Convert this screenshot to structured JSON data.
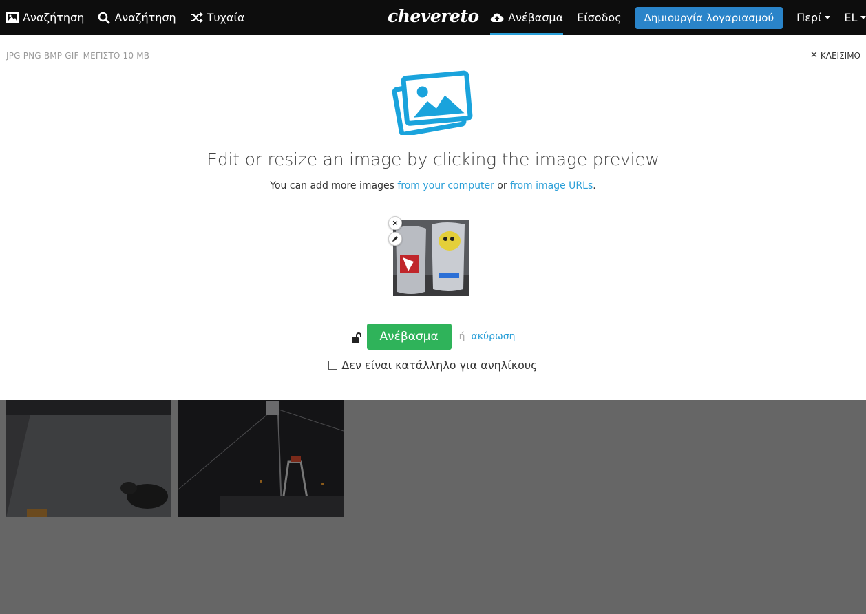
{
  "nav": {
    "images_label": "Αναζήτηση",
    "search_label": "Αναζήτηση",
    "random_label": "Τυχαία",
    "logo_text": "chevereto",
    "upload_label": "Ανέβασμα",
    "login_label": "Είσοδος",
    "signup_label": "Δημιουργία λογαριασμού",
    "about_label": "Περί",
    "language_label": "EL"
  },
  "panel": {
    "formats": "JPG PNG BMP GIF",
    "max_size": "ΜΕΓΙΣΤΟ 10 MB",
    "close_label": "ΚΛΕΙΣΙΜΟ",
    "headline": "Edit or resize an image by clicking the image preview",
    "subline_prefix": "You can add more images ",
    "link_computer": "from your computer",
    "subline_mid": " or ",
    "link_urls": "from image URLs",
    "subline_suffix": ".",
    "upload_button": "Ανέβασμα",
    "or_text": "ή",
    "cancel_link": "ακύρωση",
    "adult_label": "Δεν είναι κατάλληλο για ανηλίκους"
  },
  "icons": {
    "images": "image-icon",
    "search": "search-icon",
    "random": "shuffle-icon",
    "upload": "cloud-upload-icon",
    "close": "close-icon",
    "remove": "remove-icon",
    "edit": "pencil-icon",
    "lock": "unlock-icon",
    "uploader": "pictures-icon"
  },
  "colors": {
    "accent": "#2a9fd8",
    "signup": "#2a84c9",
    "upload_button": "#2fb35a",
    "topbar": "#0d0d0d",
    "overlay": "#666666"
  }
}
